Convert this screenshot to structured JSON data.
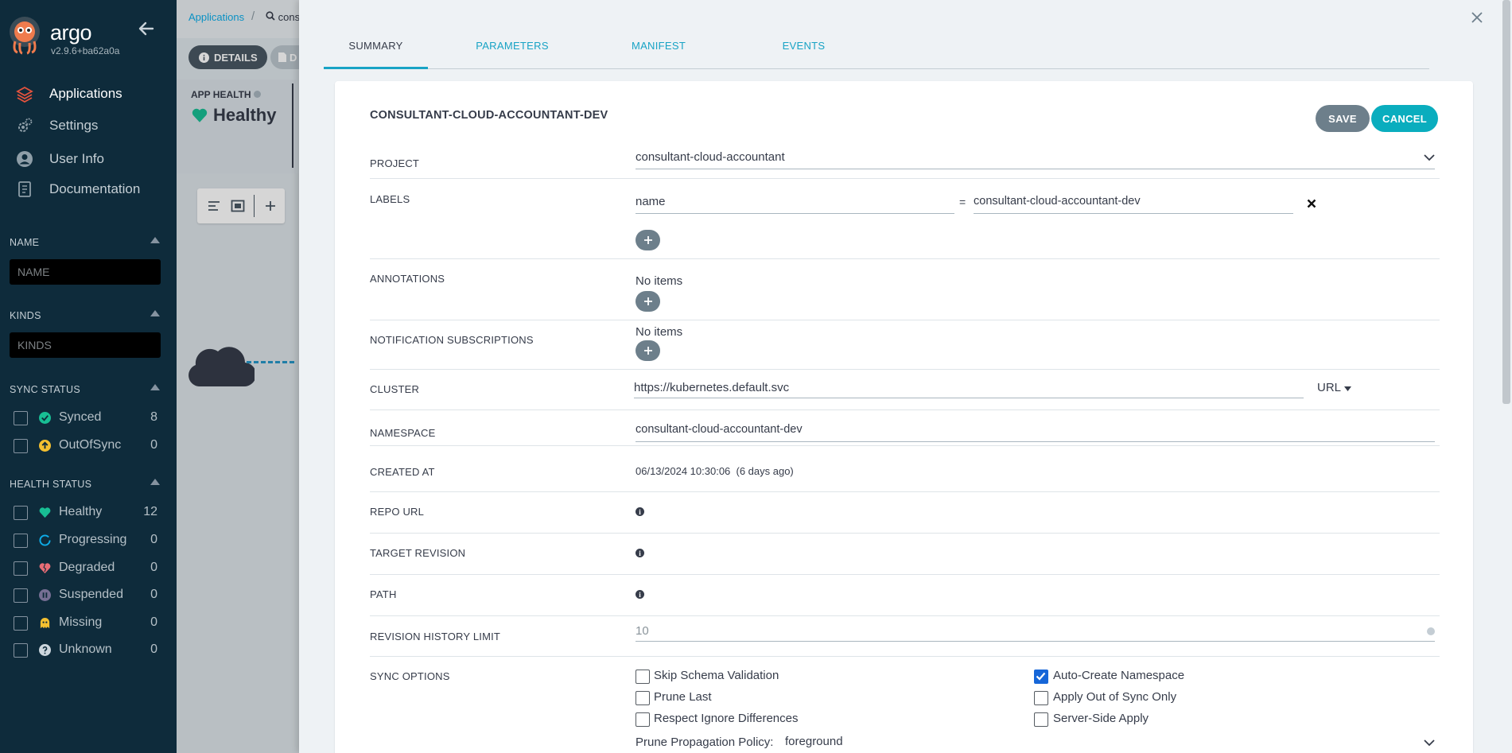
{
  "sidebar": {
    "brand": "argo",
    "version": "v2.9.6+ba62a0a",
    "nav": [
      {
        "label": "Applications"
      },
      {
        "label": "Settings"
      },
      {
        "label": "User Info"
      },
      {
        "label": "Documentation"
      }
    ],
    "filters": {
      "name": {
        "title": "NAME",
        "placeholder": "NAME"
      },
      "kinds": {
        "title": "KINDS",
        "placeholder": "KINDS"
      },
      "sync_status": {
        "title": "SYNC STATUS",
        "items": [
          {
            "label": "Synced",
            "count": "8",
            "icon": "check-circle-icon",
            "color": "#18be94"
          },
          {
            "label": "OutOfSync",
            "count": "0",
            "icon": "arrow-up-circle-icon",
            "color": "#f4c030"
          }
        ]
      },
      "health_status": {
        "title": "HEALTH STATUS",
        "items": [
          {
            "label": "Healthy",
            "count": "12",
            "icon": "heart-icon",
            "color": "#18be94"
          },
          {
            "label": "Progressing",
            "count": "0",
            "icon": "progress-circle-icon",
            "color": "#0dadea"
          },
          {
            "label": "Degraded",
            "count": "0",
            "icon": "broken-heart-icon",
            "color": "#e96d76"
          },
          {
            "label": "Suspended",
            "count": "0",
            "icon": "pause-circle-icon",
            "color": "#766f94"
          },
          {
            "label": "Missing",
            "count": "0",
            "icon": "ghost-icon",
            "color": "#f4c030"
          },
          {
            "label": "Unknown",
            "count": "0",
            "icon": "question-circle-icon",
            "color": "#ccd6dd"
          }
        ]
      }
    }
  },
  "background": {
    "breadcrumb": "Applications",
    "search_text": "cons",
    "details_button": "DETAILS",
    "diff_button": "D",
    "app_health_label": "APP HEALTH",
    "health_value": "Healthy"
  },
  "panel": {
    "tabs": [
      {
        "label": "SUMMARY",
        "active": true
      },
      {
        "label": "PARAMETERS",
        "active": false
      },
      {
        "label": "MANIFEST",
        "active": false
      },
      {
        "label": "EVENTS",
        "active": false
      }
    ],
    "title": "CONSULTANT-CLOUD-ACCOUNTANT-DEV",
    "save_label": "SAVE",
    "cancel_label": "CANCEL",
    "project": {
      "label": "PROJECT",
      "value": "consultant-cloud-accountant"
    },
    "labels": {
      "label": "LABELS",
      "key": "name",
      "equals": "=",
      "value": "consultant-cloud-accountant-dev"
    },
    "annotations": {
      "label": "ANNOTATIONS",
      "empty": "No items"
    },
    "notifications": {
      "label": "NOTIFICATION SUBSCRIPTIONS",
      "empty": "No items"
    },
    "cluster": {
      "label": "CLUSTER",
      "value": "https://kubernetes.default.svc",
      "type": "URL"
    },
    "namespace": {
      "label": "NAMESPACE",
      "value": "consultant-cloud-accountant-dev"
    },
    "created_at": {
      "label": "CREATED AT",
      "value": "06/13/2024 10:30:06  (6 days ago)"
    },
    "repo_url": {
      "label": "REPO URL"
    },
    "target_revision": {
      "label": "TARGET REVISION"
    },
    "path": {
      "label": "PATH"
    },
    "revision_history": {
      "label": "REVISION HISTORY LIMIT",
      "placeholder": "10"
    },
    "sync_options": {
      "label": "SYNC OPTIONS",
      "left": [
        {
          "label": "Skip Schema Validation",
          "checked": false
        },
        {
          "label": "Prune Last",
          "checked": false
        },
        {
          "label": "Respect Ignore Differences",
          "checked": false
        }
      ],
      "right": [
        {
          "label": "Auto-Create Namespace",
          "checked": true
        },
        {
          "label": "Apply Out of Sync Only",
          "checked": false
        },
        {
          "label": "Server-Side Apply",
          "checked": false
        }
      ],
      "prune_policy_label": "Prune Propagation Policy:",
      "prune_policy_value": "foreground"
    }
  }
}
